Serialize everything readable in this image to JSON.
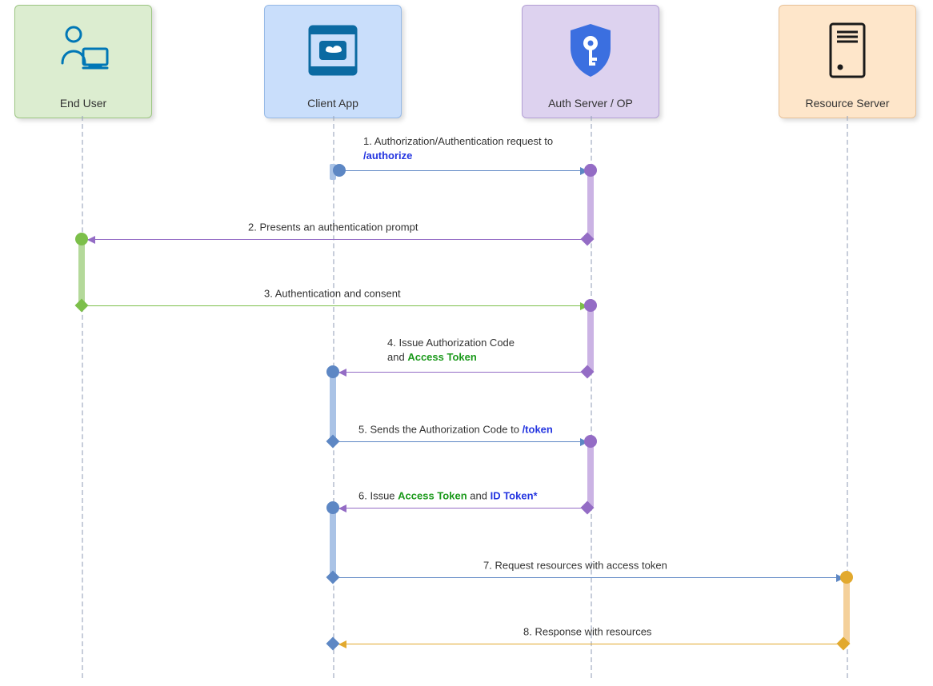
{
  "lanes": {
    "user": {
      "label": "End User"
    },
    "client": {
      "label": "Client App"
    },
    "auth": {
      "label": "Auth Server / OP"
    },
    "resource": {
      "label": "Resource Server"
    }
  },
  "messages": {
    "m1": {
      "num": "1.",
      "text": "Authorization/Authentication request to",
      "endpoint": "/authorize"
    },
    "m2": {
      "num": "2.",
      "text": "Presents an authentication prompt"
    },
    "m3": {
      "num": "3.",
      "text": "Authentication and consent"
    },
    "m4": {
      "num": "4.",
      "text_a": "Issue Authorization Code",
      "text_b": "and",
      "token": "Access Token"
    },
    "m5": {
      "num": "5.",
      "text": "Sends the Authorization Code to",
      "endpoint": "/token"
    },
    "m6": {
      "num": "6.",
      "text_a": "Issue",
      "token1": "Access Token",
      "text_b": "and",
      "token2": "ID Token*"
    },
    "m7": {
      "num": "7.",
      "text": "Request resources with access token"
    },
    "m8": {
      "num": "8.",
      "text": "Response with resources"
    }
  },
  "chart_data": {
    "type": "sequence-diagram",
    "participants": [
      {
        "id": "user",
        "label": "End User"
      },
      {
        "id": "client",
        "label": "Client App"
      },
      {
        "id": "auth",
        "label": "Auth Server / OP"
      },
      {
        "id": "resource",
        "label": "Resource Server"
      }
    ],
    "messages": [
      {
        "step": 1,
        "from": "client",
        "to": "auth",
        "label": "Authorization/Authentication request to /authorize"
      },
      {
        "step": 2,
        "from": "auth",
        "to": "user",
        "label": "Presents an authentication prompt"
      },
      {
        "step": 3,
        "from": "user",
        "to": "auth",
        "label": "Authentication and consent"
      },
      {
        "step": 4,
        "from": "auth",
        "to": "client",
        "label": "Issue Authorization Code and Access Token"
      },
      {
        "step": 5,
        "from": "client",
        "to": "auth",
        "label": "Sends the Authorization Code to /token"
      },
      {
        "step": 6,
        "from": "auth",
        "to": "client",
        "label": "Issue Access Token and ID Token*"
      },
      {
        "step": 7,
        "from": "client",
        "to": "resource",
        "label": "Request resources with access token"
      },
      {
        "step": 8,
        "from": "resource",
        "to": "client",
        "label": "Response with resources"
      }
    ]
  }
}
